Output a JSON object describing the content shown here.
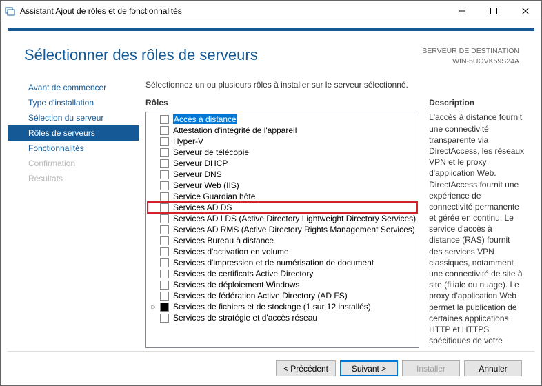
{
  "window": {
    "title": "Assistant Ajout de rôles et de fonctionnalités"
  },
  "header": {
    "title": "Sélectionner des rôles de serveurs",
    "dest_label": "SERVEUR DE DESTINATION",
    "dest_server": "WIN-5UOVK59S24A"
  },
  "sidebar": {
    "steps": [
      {
        "label": "Avant de commencer",
        "state": "normal"
      },
      {
        "label": "Type d'installation",
        "state": "normal"
      },
      {
        "label": "Sélection du serveur",
        "state": "normal"
      },
      {
        "label": "Rôles de serveurs",
        "state": "selected"
      },
      {
        "label": "Fonctionnalités",
        "state": "normal"
      },
      {
        "label": "Confirmation",
        "state": "disabled"
      },
      {
        "label": "Résultats",
        "state": "disabled"
      }
    ]
  },
  "main": {
    "instruction": "Sélectionnez un ou plusieurs rôles à installer sur le serveur sélectionné.",
    "roles_label": "Rôles",
    "desc_label": "Description",
    "roles": [
      {
        "label": "Accès à distance",
        "selected": true
      },
      {
        "label": "Attestation d'intégrité de l'appareil"
      },
      {
        "label": "Hyper-V"
      },
      {
        "label": "Serveur de télécopie"
      },
      {
        "label": "Serveur DHCP"
      },
      {
        "label": "Serveur DNS"
      },
      {
        "label": "Serveur Web (IIS)"
      },
      {
        "label": "Service Guardian hôte"
      },
      {
        "label": "Services AD DS",
        "highlight": true
      },
      {
        "label": "Services AD LDS (Active Directory Lightweight Directory Services)"
      },
      {
        "label": "Services AD RMS (Active Directory Rights Management Services)"
      },
      {
        "label": "Services Bureau à distance"
      },
      {
        "label": "Services d'activation en volume"
      },
      {
        "label": "Services d'impression et de numérisation de document"
      },
      {
        "label": "Services de certificats Active Directory"
      },
      {
        "label": "Services de déploiement Windows"
      },
      {
        "label": "Services de fédération Active Directory (AD FS)"
      },
      {
        "label": "Services de fichiers et de stockage (1 sur 12 installés)",
        "expandable": true,
        "checked_partial": true
      },
      {
        "label": "Services de stratégie et d'accès réseau"
      }
    ],
    "description": "L'accès à distance fournit une connectivité transparente via DirectAccess, les réseaux VPN et le proxy d'application Web. DirectAccess fournit une expérience de connectivité permanente et gérée en continu. Le service d'accès à distance (RAS) fournit des services VPN classiques, notamment une connectivité de site à site (filiale ou nuage). Le proxy d'application Web permet la publication de certaines applications HTTP et HTTPS spécifiques de votre réseau d'entreprise à destination d'appareils clients situés hors du réseau d'entreprise. Le routage fournit des fonctionnalités de routage classiques, notamment la traduction d'adresses réseau"
  },
  "footer": {
    "prev": "< Précédent",
    "next": "Suivant >",
    "install": "Installer",
    "cancel": "Annuler"
  }
}
